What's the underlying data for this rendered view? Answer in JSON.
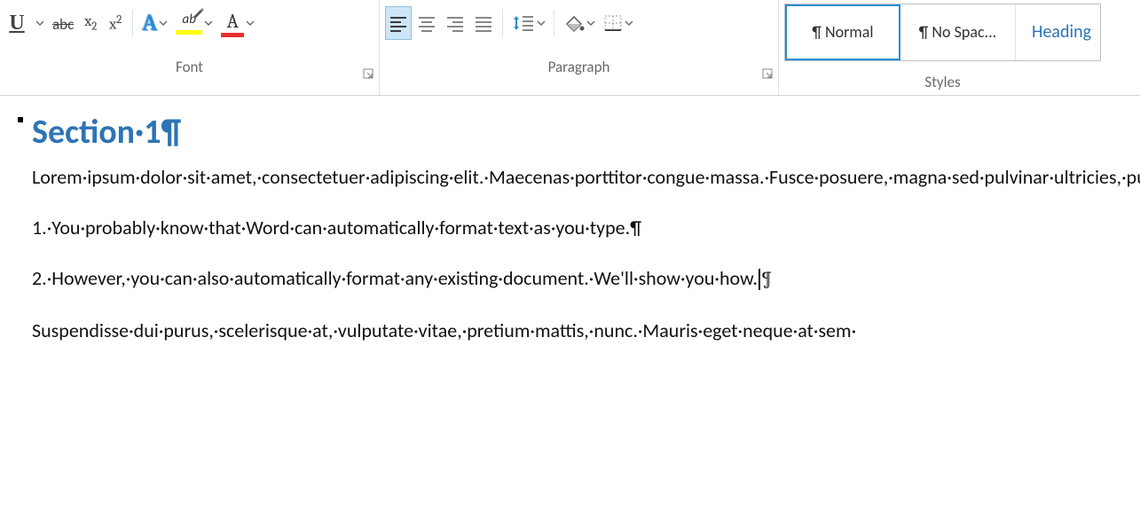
{
  "ribbon": {
    "font": {
      "label": "Font",
      "underline": "U",
      "strike": "abc",
      "subscript_base": "x",
      "subscript_sub": "2",
      "superscript_base": "x",
      "superscript_sup": "2",
      "text_effects_glyph": "A",
      "highlight_glyph": "ab",
      "font_color_glyph": "A"
    },
    "paragraph": {
      "label": "Paragraph"
    },
    "styles": {
      "label": "Styles",
      "normal": "¶ Normal",
      "nospacing": "¶ No Spac...",
      "heading1": "Heading"
    }
  },
  "doc": {
    "heading": "Section·1¶",
    "para1": "Lorem·ipsum·dolor·sit·amet,·consectetuer·adipiscing·elit.·Maecenas·porttitor·congue·massa.·Fusce·posuere,·magna·sed·pulvinar·ultricies,·purus·lectus·malesuada·libero,·sit·amet·commodo·magna·eros·quis·urna.·Nunc·viverra·imperdiet·enim,·http://www.howtogeek.com.·Fusce·est.·Vivamus·a·tellus.·Pellentesque·habitant·morbi·tristique·senectus·et·netus·et·malesuada·fames·ac·turpis·egestas.·Proin·pharetra·nonummy·pede,·lori@howtogeek.com.·Mauris·et·orci.·Aenean·nec·lorem.·In·porttitor.·Donec·laoreet·nonummy·augue.¶",
    "para2": "1.·You·probably·know·that·Word·can·automatically·format·text·as·you·type.¶",
    "para3_pre": "2.·However,·you·can·also·automatically·format·any·existing·document.·We'll·show·you·how.",
    "para3_post": "¶",
    "para4": "Suspendisse·dui·purus,·scelerisque·at,·vulputate·vitae,·pretium·mattis,·nunc.·Mauris·eget·neque·at·sem·"
  }
}
